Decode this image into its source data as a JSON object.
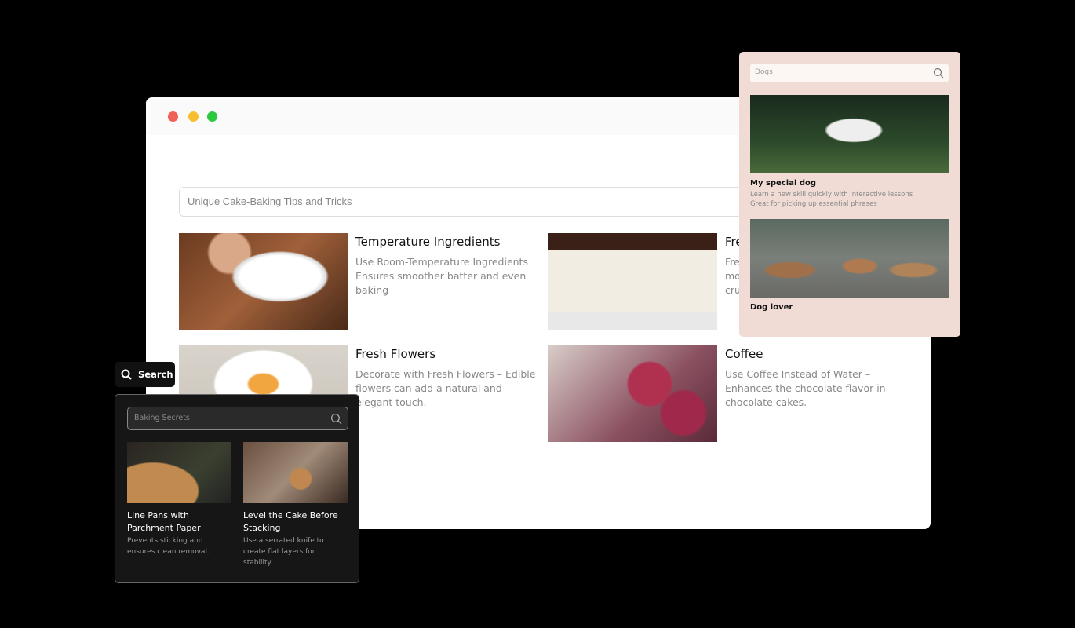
{
  "window": {
    "controls": {
      "close": "#f25f58",
      "minimize": "#f9be2f",
      "maximize": "#2bc840"
    }
  },
  "main": {
    "search_value": "Unique Cake-Baking Tips and Tricks",
    "cards": [
      {
        "title": "Temperature Ingredients",
        "desc": "Use Room-Temperature Ingredients Ensures smoother batter and even baking"
      },
      {
        "title": "Fre",
        "desc": "Fre mo cru"
      },
      {
        "title": "Fresh Flowers",
        "desc": "Decorate with Fresh Flowers – Edible flowers can add a natural and elegant touch."
      },
      {
        "title": "Coffee",
        "desc": "Use Coffee Instead of Water – Enhances the chocolate flavor in chocolate cakes."
      }
    ]
  },
  "dog_panel": {
    "search_placeholder": "Dogs",
    "icon": "search-icon",
    "bg": "#f0dcd5",
    "items": [
      {
        "title": "My special dog",
        "desc1": "Learn a new skill quickly with interactive lessons",
        "desc2": "Great for picking up essential phrases"
      },
      {
        "title": "Dog lover"
      }
    ]
  },
  "search_button": {
    "label": "Search",
    "icon": "search-icon"
  },
  "dark_panel": {
    "search_placeholder": "Baking Secrets",
    "items": [
      {
        "title": "Line Pans with Parchment Paper",
        "desc": "Prevents sticking and ensures clean removal."
      },
      {
        "title": "Level the Cake Before Stacking",
        "desc": "Use a serrated knife to create flat layers for stability."
      }
    ]
  }
}
